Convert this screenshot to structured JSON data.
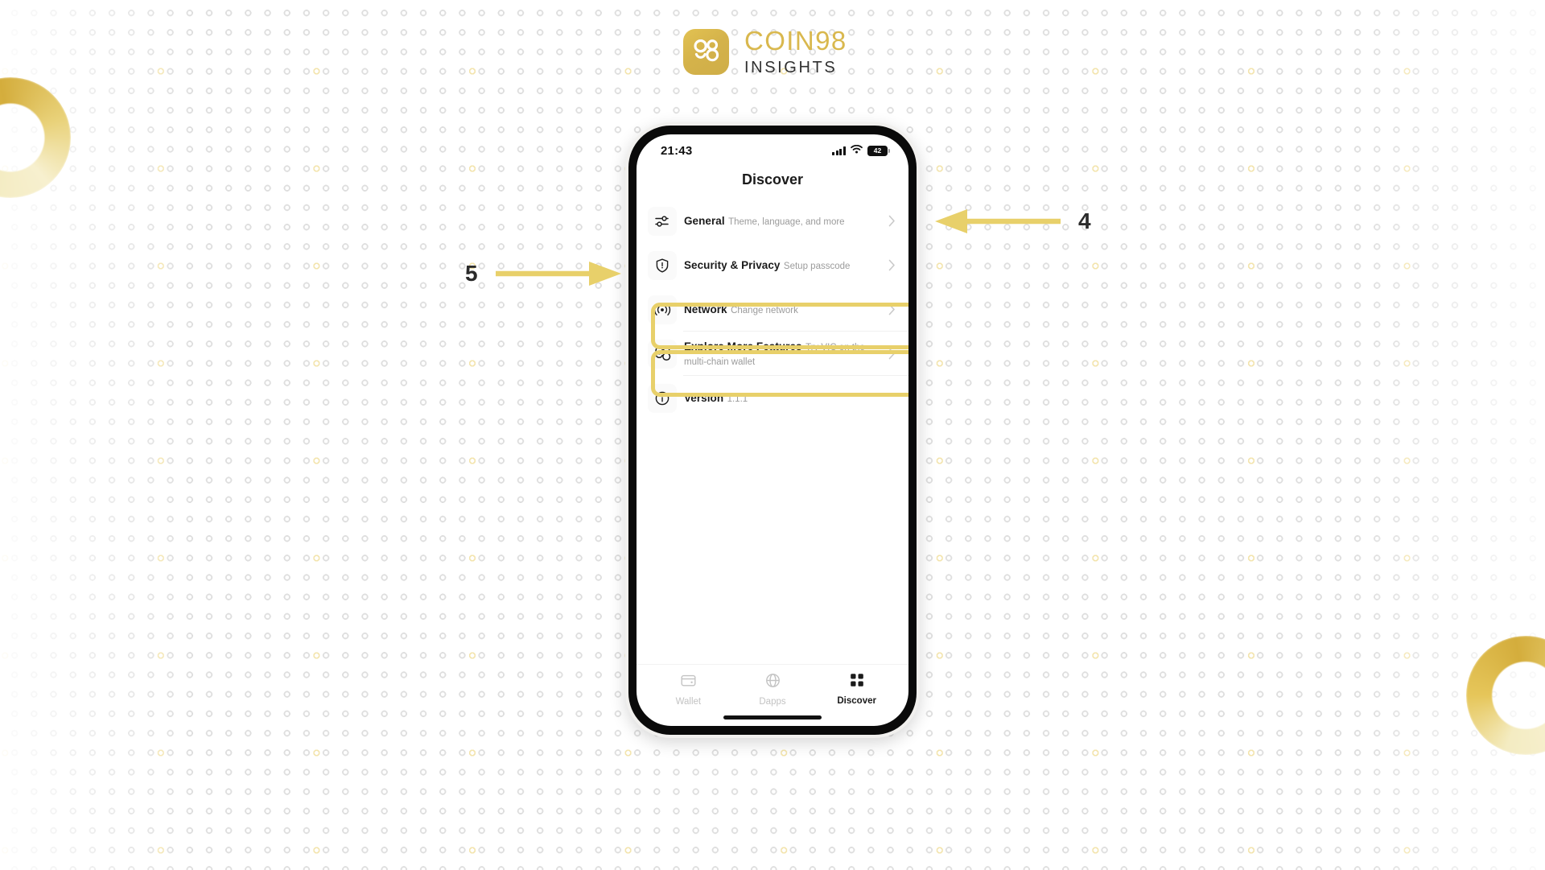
{
  "brand": {
    "logo_mark_icon": "coin98-logo-icon",
    "name_primary": "COIN98",
    "name_secondary": "INSIGHTS",
    "gold": "#e8d06a",
    "logo_gold": "#d9b84e"
  },
  "phone": {
    "status_bar": {
      "time": "21:43",
      "cellular_icon": "cellular-signal-icon",
      "wifi_icon": "wifi-icon",
      "battery_icon": "battery-icon",
      "battery_level": "42"
    },
    "nav": {
      "title": "Discover"
    },
    "settings": {
      "rows": [
        {
          "icon": "sliders-icon",
          "title": "General",
          "subtitle": "Theme, language, and more",
          "chevron": "chevron-right-icon"
        },
        {
          "icon": "shield-alert-icon",
          "title": "Security & Privacy",
          "subtitle": "Setup passcode",
          "chevron": "chevron-right-icon"
        },
        {
          "icon": "broadcast-icon",
          "title": "Network",
          "subtitle": "Change network",
          "chevron": "chevron-right-icon"
        },
        {
          "icon": "coin98-icon",
          "title": "Explore More Features",
          "subtitle": "Try VIC on the multi-chain wallet",
          "chevron": "chevron-right-icon"
        },
        {
          "icon": "info-circle-icon",
          "title": "Version",
          "subtitle": "1.1.1",
          "chevron": ""
        }
      ]
    },
    "tab_bar": {
      "tabs": [
        {
          "icon": "wallet-icon",
          "label": "Wallet",
          "active": false
        },
        {
          "icon": "globe-icon",
          "label": "Dapps",
          "active": false
        },
        {
          "icon": "grid-icon",
          "label": "Discover",
          "active": true
        }
      ]
    }
  },
  "annotations": [
    {
      "number": "4",
      "direction": "left",
      "target": "General row"
    },
    {
      "number": "5",
      "direction": "right",
      "target": "Security & Privacy row"
    }
  ]
}
